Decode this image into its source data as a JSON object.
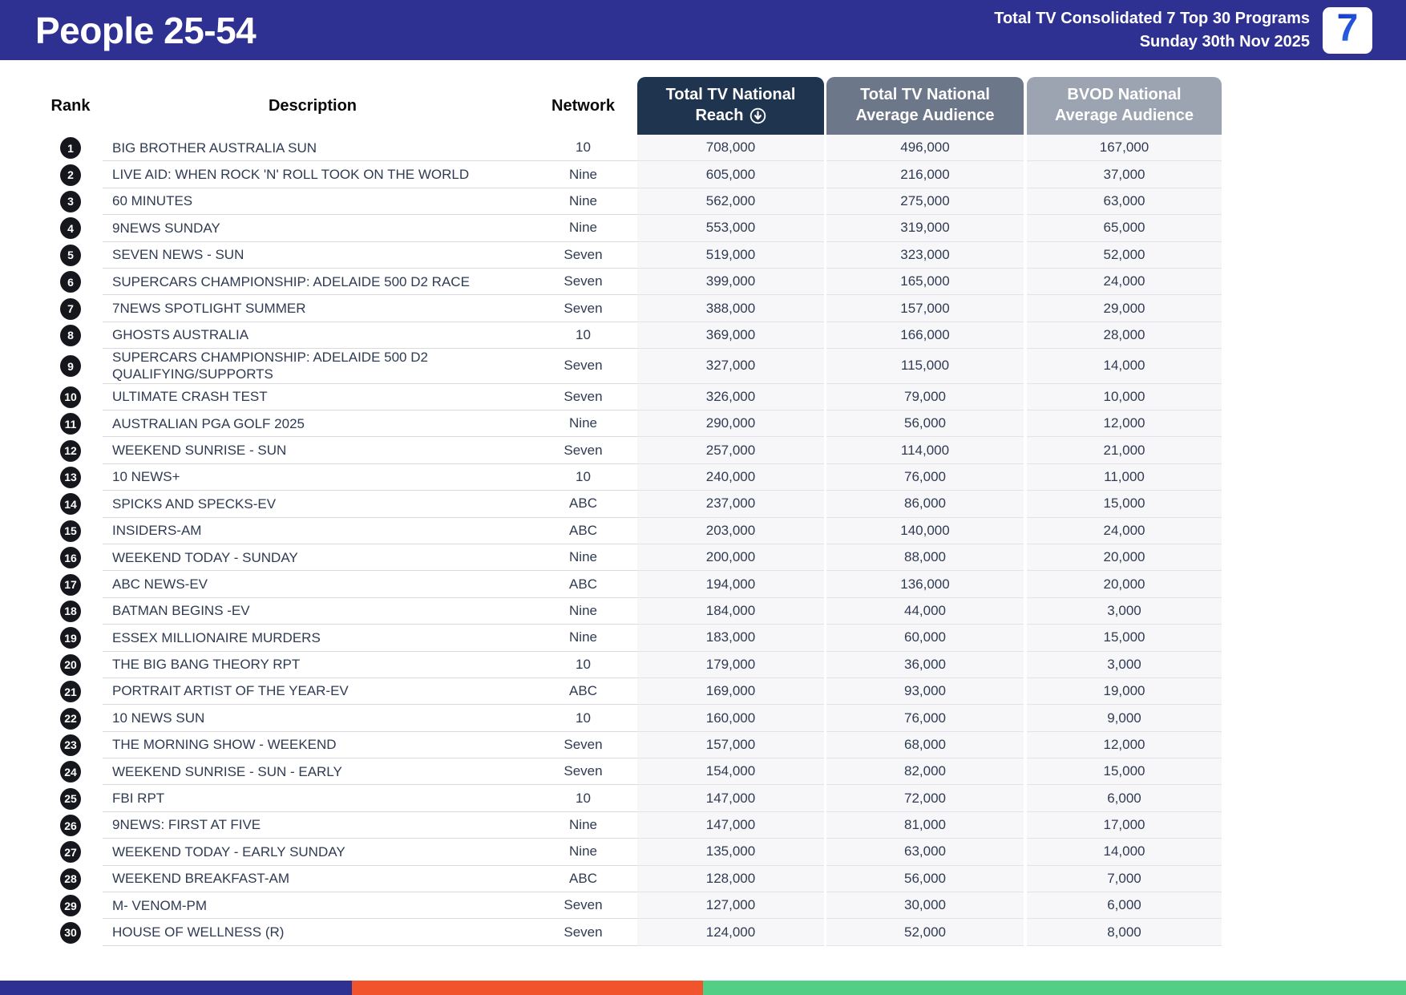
{
  "header": {
    "title": "People 25-54",
    "subtitle_line1": "Total TV Consolidated 7 Top 30 Programs",
    "subtitle_line2": "Sunday 30th Nov 2025",
    "logo_text": "7",
    "bg_color": "#2E3192"
  },
  "table": {
    "columns": {
      "rank": "Rank",
      "description": "Description",
      "network": "Network",
      "reach_line1": "Total TV National",
      "reach_line2": "Reach",
      "avg_line1": "Total TV National",
      "avg_line2": "Average Audience",
      "bvod_line1": "BVOD National",
      "bvod_line2": "Average Audience"
    },
    "sort_icon": "circled-down-arrow",
    "header_colors": {
      "reach": "#1F344E",
      "avg": "#6C7789",
      "bvod": "#9CA4B1"
    },
    "rows": [
      {
        "rank": "1",
        "description": "BIG BROTHER AUSTRALIA SUN",
        "network": "10",
        "reach": "708,000",
        "avg_audience": "496,000",
        "bvod_audience": "167,000"
      },
      {
        "rank": "2",
        "description": "LIVE AID: WHEN ROCK 'N' ROLL TOOK ON THE WORLD",
        "network": "Nine",
        "reach": "605,000",
        "avg_audience": "216,000",
        "bvod_audience": "37,000"
      },
      {
        "rank": "3",
        "description": "60 MINUTES",
        "network": "Nine",
        "reach": "562,000",
        "avg_audience": "275,000",
        "bvod_audience": "63,000"
      },
      {
        "rank": "4",
        "description": "9NEWS SUNDAY",
        "network": "Nine",
        "reach": "553,000",
        "avg_audience": "319,000",
        "bvod_audience": "65,000"
      },
      {
        "rank": "5",
        "description": "SEVEN NEWS - SUN",
        "network": "Seven",
        "reach": "519,000",
        "avg_audience": "323,000",
        "bvod_audience": "52,000"
      },
      {
        "rank": "6",
        "description": "SUPERCARS CHAMPIONSHIP: ADELAIDE 500 D2 RACE",
        "network": "Seven",
        "reach": "399,000",
        "avg_audience": "165,000",
        "bvod_audience": "24,000"
      },
      {
        "rank": "7",
        "description": "7NEWS SPOTLIGHT SUMMER",
        "network": "Seven",
        "reach": "388,000",
        "avg_audience": "157,000",
        "bvod_audience": "29,000"
      },
      {
        "rank": "8",
        "description": "GHOSTS AUSTRALIA",
        "network": "10",
        "reach": "369,000",
        "avg_audience": "166,000",
        "bvod_audience": "28,000"
      },
      {
        "rank": "9",
        "description": "SUPERCARS CHAMPIONSHIP: ADELAIDE 500 D2 QUALIFYING/SUPPORTS",
        "network": "Seven",
        "reach": "327,000",
        "avg_audience": "115,000",
        "bvod_audience": "14,000"
      },
      {
        "rank": "10",
        "description": "ULTIMATE CRASH TEST",
        "network": "Seven",
        "reach": "326,000",
        "avg_audience": "79,000",
        "bvod_audience": "10,000"
      },
      {
        "rank": "11",
        "description": "AUSTRALIAN PGA GOLF 2025",
        "network": "Nine",
        "reach": "290,000",
        "avg_audience": "56,000",
        "bvod_audience": "12,000"
      },
      {
        "rank": "12",
        "description": "WEEKEND SUNRISE - SUN",
        "network": "Seven",
        "reach": "257,000",
        "avg_audience": "114,000",
        "bvod_audience": "21,000"
      },
      {
        "rank": "13",
        "description": "10 NEWS+",
        "network": "10",
        "reach": "240,000",
        "avg_audience": "76,000",
        "bvod_audience": "11,000"
      },
      {
        "rank": "14",
        "description": "SPICKS AND SPECKS-EV",
        "network": "ABC",
        "reach": "237,000",
        "avg_audience": "86,000",
        "bvod_audience": "15,000"
      },
      {
        "rank": "15",
        "description": "INSIDERS-AM",
        "network": "ABC",
        "reach": "203,000",
        "avg_audience": "140,000",
        "bvod_audience": "24,000"
      },
      {
        "rank": "16",
        "description": "WEEKEND TODAY - SUNDAY",
        "network": "Nine",
        "reach": "200,000",
        "avg_audience": "88,000",
        "bvod_audience": "20,000"
      },
      {
        "rank": "17",
        "description": "ABC NEWS-EV",
        "network": "ABC",
        "reach": "194,000",
        "avg_audience": "136,000",
        "bvod_audience": "20,000"
      },
      {
        "rank": "18",
        "description": "BATMAN BEGINS -EV",
        "network": "Nine",
        "reach": "184,000",
        "avg_audience": "44,000",
        "bvod_audience": "3,000"
      },
      {
        "rank": "19",
        "description": "ESSEX MILLIONAIRE MURDERS",
        "network": "Nine",
        "reach": "183,000",
        "avg_audience": "60,000",
        "bvod_audience": "15,000"
      },
      {
        "rank": "20",
        "description": "THE BIG BANG THEORY RPT",
        "network": "10",
        "reach": "179,000",
        "avg_audience": "36,000",
        "bvod_audience": "3,000"
      },
      {
        "rank": "21",
        "description": "PORTRAIT ARTIST OF THE YEAR-EV",
        "network": "ABC",
        "reach": "169,000",
        "avg_audience": "93,000",
        "bvod_audience": "19,000"
      },
      {
        "rank": "22",
        "description": "10 NEWS SUN",
        "network": "10",
        "reach": "160,000",
        "avg_audience": "76,000",
        "bvod_audience": "9,000"
      },
      {
        "rank": "23",
        "description": "THE MORNING SHOW - WEEKEND",
        "network": "Seven",
        "reach": "157,000",
        "avg_audience": "68,000",
        "bvod_audience": "12,000"
      },
      {
        "rank": "24",
        "description": "WEEKEND SUNRISE - SUN - EARLY",
        "network": "Seven",
        "reach": "154,000",
        "avg_audience": "82,000",
        "bvod_audience": "15,000"
      },
      {
        "rank": "25",
        "description": "FBI RPT",
        "network": "10",
        "reach": "147,000",
        "avg_audience": "72,000",
        "bvod_audience": "6,000"
      },
      {
        "rank": "26",
        "description": "9NEWS: FIRST AT FIVE",
        "network": "Nine",
        "reach": "147,000",
        "avg_audience": "81,000",
        "bvod_audience": "17,000"
      },
      {
        "rank": "27",
        "description": "WEEKEND TODAY - EARLY SUNDAY",
        "network": "Nine",
        "reach": "135,000",
        "avg_audience": "63,000",
        "bvod_audience": "14,000"
      },
      {
        "rank": "28",
        "description": "WEEKEND BREAKFAST-AM",
        "network": "ABC",
        "reach": "128,000",
        "avg_audience": "56,000",
        "bvod_audience": "7,000"
      },
      {
        "rank": "29",
        "description": "M- VENOM-PM",
        "network": "Seven",
        "reach": "127,000",
        "avg_audience": "30,000",
        "bvod_audience": "6,000"
      },
      {
        "rank": "30",
        "description": "HOUSE OF WELLNESS (R)",
        "network": "Seven",
        "reach": "124,000",
        "avg_audience": "52,000",
        "bvod_audience": "8,000"
      }
    ]
  },
  "footer": {
    "segments": [
      {
        "name": "blue",
        "color": "#2E3192",
        "width_pct": 25
      },
      {
        "name": "orange",
        "color": "#F1532C",
        "width_pct": 25
      },
      {
        "name": "green",
        "color": "#52CE85",
        "width_pct": 50
      }
    ]
  }
}
